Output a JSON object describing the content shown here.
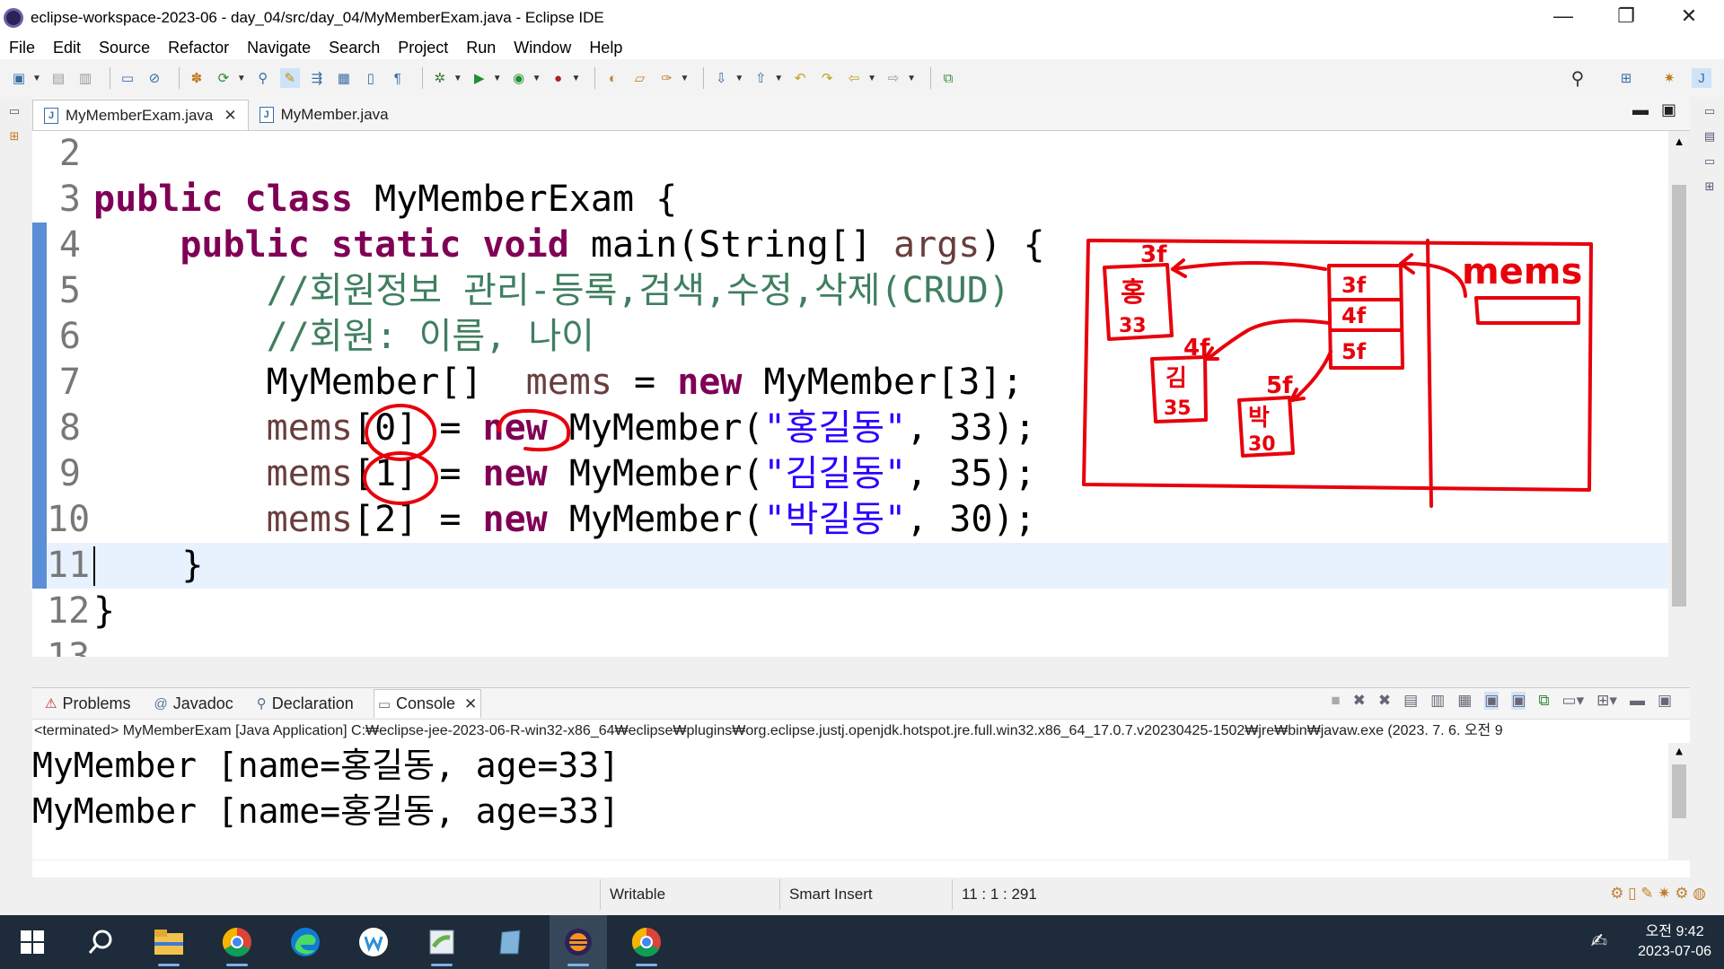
{
  "window": {
    "title": "eclipse-workspace-2023-06 - day_04/src/day_04/MyMemberExam.java - Eclipse IDE",
    "minimize": "—",
    "restore": "❐",
    "close": "✕"
  },
  "menu": [
    "File",
    "Edit",
    "Source",
    "Refactor",
    "Navigate",
    "Search",
    "Project",
    "Run",
    "Window",
    "Help"
  ],
  "editor": {
    "tabs": [
      {
        "label": "MyMemberExam.java",
        "active": true
      },
      {
        "label": "MyMember.java",
        "active": false
      }
    ],
    "lines": [
      {
        "num": "2",
        "text": ""
      },
      {
        "num": "3",
        "kw1": "public class",
        "rest": " MyMemberExam {"
      },
      {
        "num": "4",
        "indent": "    ",
        "kw1": "public static void",
        "rest": " main(String[] ",
        "var": "args",
        "tail": ") {"
      },
      {
        "num": "5",
        "indent": "        ",
        "comment": "//회원정보 관리-등록,검색,수정,삭제(CRUD)"
      },
      {
        "num": "6",
        "indent": "        ",
        "comment": "//회원: 이름, 나이"
      },
      {
        "num": "7",
        "indent": "        ",
        "pre": "MyMember[]  ",
        "var": "mems",
        "mid": " = ",
        "kw": "new",
        "tail": " MyMember[3];"
      },
      {
        "num": "8",
        "indent": "        ",
        "var": "mems",
        "mid": "[0] = ",
        "kw": "new",
        "pre2": " MyMember(",
        "str": "\"홍길동\"",
        "tail": ", 33);"
      },
      {
        "num": "9",
        "indent": "        ",
        "var": "mems",
        "mid": "[1] = ",
        "kw": "new",
        "pre2": " MyMember(",
        "str": "\"김길동\"",
        "tail": ", 35);"
      },
      {
        "num": "10",
        "indent": "        ",
        "var": "mems",
        "mid": "[2] = ",
        "kw": "new",
        "pre2": " MyMember(",
        "str": "\"박길동\"",
        "tail": ", 30);"
      },
      {
        "num": "11",
        "indent": "    ",
        "rest": "}"
      },
      {
        "num": "12",
        "rest": "}"
      },
      {
        "num": "13",
        "rest": ""
      }
    ]
  },
  "annotations": {
    "mems_label": "mems",
    "addr_3f": "3f",
    "addr_4f": "4f",
    "addr_5f": "5f",
    "cell_3f": "3f",
    "cell_4f": "4f",
    "cell_5f": "5f",
    "box1_name": "홍",
    "box1_age": "33",
    "box2_name": "김",
    "box2_age": "35",
    "box3_name": "박",
    "box3_age": "30",
    "color": "#e8000b"
  },
  "console": {
    "tabs": [
      {
        "label": "Problems",
        "icon": "problems-icon"
      },
      {
        "label": "Javadoc",
        "icon": "at-icon"
      },
      {
        "label": "Declaration",
        "icon": "declaration-icon"
      },
      {
        "label": "Console",
        "icon": "console-icon",
        "active": true
      }
    ],
    "info": "<terminated> MyMemberExam [Java Application] C:₩eclipse-jee-2023-06-R-win32-x86_64₩eclipse₩plugins₩org.eclipse.justj.openjdk.hotspot.jre.full.win32.x86_64_17.0.7.v20230425-1502₩jre₩bin₩javaw.exe  (2023. 7. 6. 오전 9",
    "output": [
      "MyMember [name=홍길동, age=33]",
      "MyMember [name=홍길동, age=33]"
    ]
  },
  "status": {
    "writable": "Writable",
    "insert": "Smart Insert",
    "position": "11 : 1 : 291"
  },
  "taskbar": {
    "time": "오전 9:42",
    "date": "2023-07-06"
  }
}
